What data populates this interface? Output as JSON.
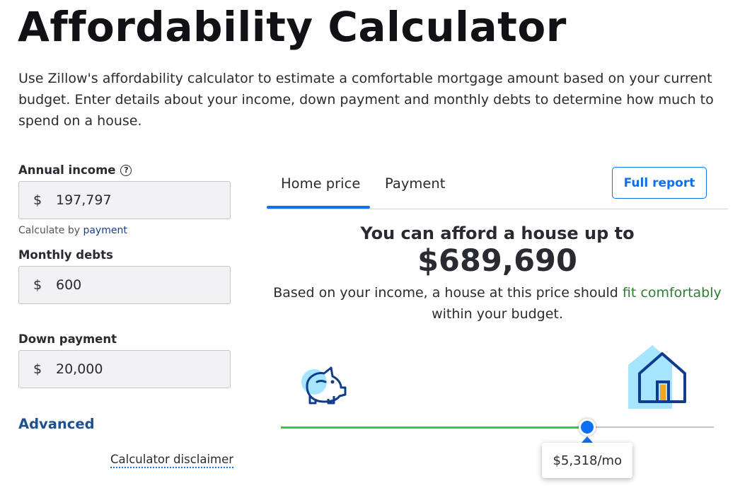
{
  "page": {
    "title": "Affordability Calculator",
    "intro": "Use Zillow's affordability calculator to estimate a comfortable mortgage amount based on your current budget. Enter details about your income, down payment and monthly debts to determine how much to spend on a house."
  },
  "form": {
    "annual_income": {
      "label": "Annual income",
      "help_glyph": "?",
      "prefix": "$",
      "value": "197,797"
    },
    "calculate_by": {
      "text": "Calculate by",
      "link": "payment"
    },
    "monthly_debts": {
      "label": "Monthly debts",
      "prefix": "$",
      "value": "600"
    },
    "down_payment": {
      "label": "Down payment",
      "prefix": "$",
      "value": "20,000"
    },
    "advanced_label": "Advanced",
    "disclaimer_label": "Calculator disclaimer"
  },
  "tabs": [
    {
      "label": "Home price",
      "active": true
    },
    {
      "label": "Payment",
      "active": false
    }
  ],
  "full_report_label": "Full report",
  "result": {
    "headline": "You can afford a house up to",
    "amount": "$689,690",
    "desc_before": "Based on your income, a house at this price should ",
    "desc_highlight": "fit comfortably",
    "desc_after": " within your budget."
  },
  "slider": {
    "fraction": 0.708,
    "tooltip": "$5,318/mo"
  },
  "icons": {
    "start": "piggy-bank-icon",
    "end": "house-icon"
  },
  "colors": {
    "accent": "#0d6ff2",
    "positive": "#2e7d32",
    "slider_fill": "#2ecc40",
    "navy": "#1d4f91",
    "icon_light": "#a6e5ff"
  }
}
